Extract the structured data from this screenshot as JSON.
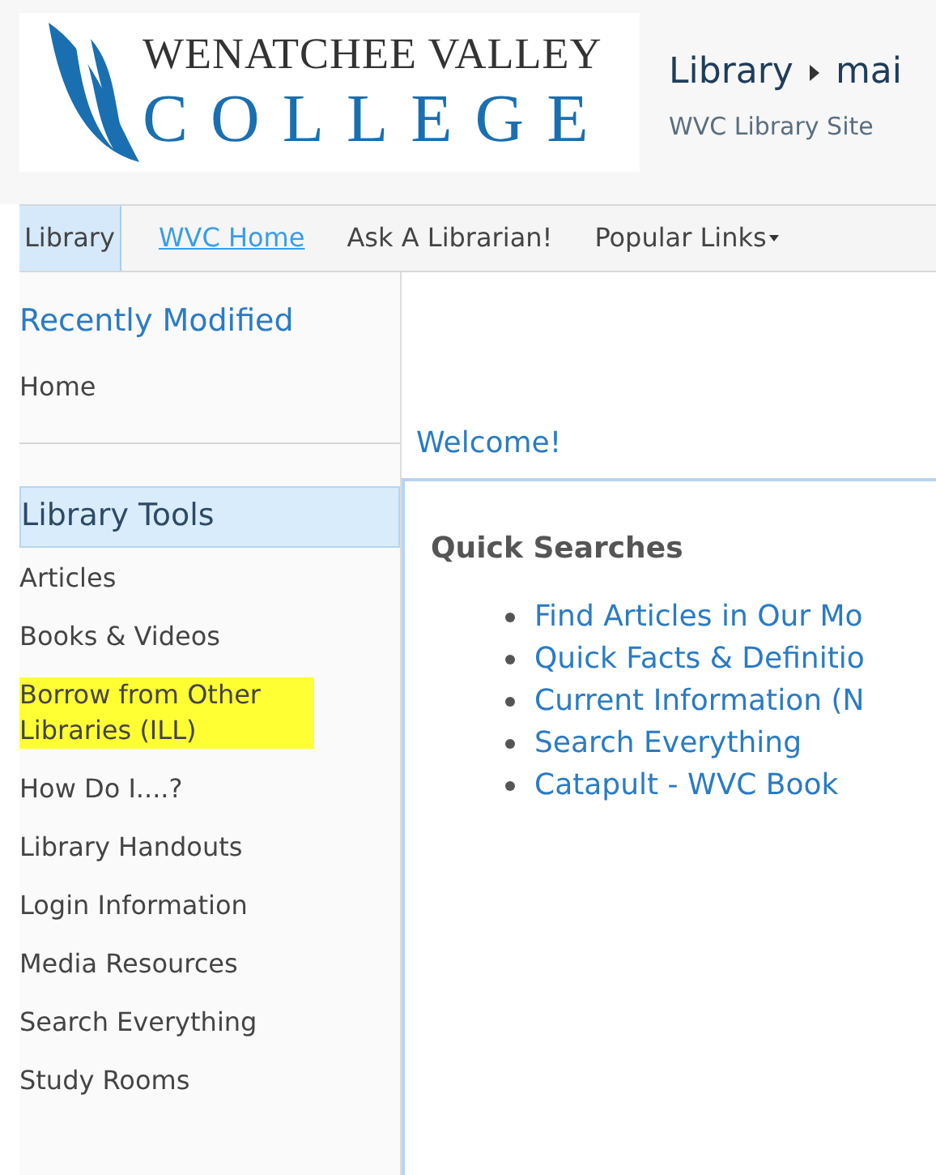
{
  "logo": {
    "line_1": "WENATCHEE VALLEY",
    "line_2": "COLLEGE"
  },
  "breadcrumb": {
    "items": [
      "Library",
      "mai"
    ],
    "subtitle": "WVC Library Site"
  },
  "nav": [
    {
      "label": "Library",
      "selected": true,
      "kind": "tab"
    },
    {
      "label": "WVC Home",
      "selected": false,
      "kind": "link"
    },
    {
      "label": "Ask A Librarian!",
      "selected": false,
      "kind": "tab"
    },
    {
      "label": "Popular Links",
      "selected": false,
      "kind": "menu"
    }
  ],
  "sidebar": {
    "recent": {
      "title": "Recently Modified",
      "items": [
        "Home"
      ]
    },
    "tools": {
      "title": "Library Tools",
      "items": [
        {
          "label": "Articles",
          "highlighted": false
        },
        {
          "label": "Books & Videos",
          "highlighted": false
        },
        {
          "label": "Borrow from Other Libraries (ILL)",
          "highlighted": true
        },
        {
          "label": "How Do I....?",
          "highlighted": false
        },
        {
          "label": "Library Handouts",
          "highlighted": false
        },
        {
          "label": "Login Information",
          "highlighted": false
        },
        {
          "label": "Media Resources",
          "highlighted": false
        },
        {
          "label": "Search Everything",
          "highlighted": false
        },
        {
          "label": "Study Rooms",
          "highlighted": false
        }
      ]
    }
  },
  "content": {
    "welcome": "Welcome!",
    "heading": "Quick Searches",
    "links": [
      "Find Articles in Our Mo",
      "Quick Facts & Definitio",
      "Current Information (N",
      "Search Everything",
      "Catapult - WVC Book"
    ]
  }
}
